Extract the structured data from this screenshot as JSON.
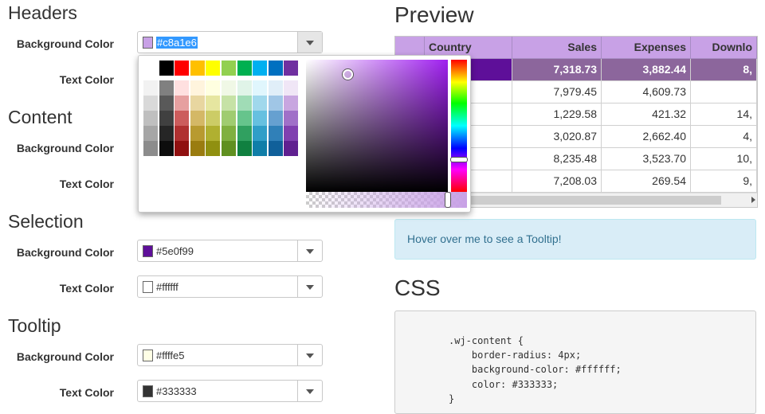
{
  "sections": {
    "headers": {
      "title": "Headers",
      "bg_label": "Background Color",
      "bg_value": "#c8a1e6",
      "bg_color": "#c8a1e6",
      "text_label": "Text Color"
    },
    "content": {
      "title": "Content",
      "bg_label": "Background Color",
      "text_label": "Text Color"
    },
    "selection": {
      "title": "Selection",
      "bg_label": "Background Color",
      "bg_value": "#5e0f99",
      "bg_color": "#5e0f99",
      "text_label": "Text Color",
      "text_value": "#ffffff",
      "text_color": "#ffffff"
    },
    "tooltip": {
      "title": "Tooltip",
      "bg_label": "Background Color",
      "bg_value": "#ffffe5",
      "bg_color": "#ffffe5",
      "text_label": "Text Color",
      "text_value": "#333333",
      "text_color": "#333333"
    }
  },
  "picker": {
    "palette_top": [
      "#ffffff",
      "#000000",
      "#ff0000",
      "#ffc000",
      "#ffff00",
      "#92d050",
      "#00b050",
      "#00b0f0",
      "#0070c0",
      "#7030a0"
    ],
    "palette_shades": [
      [
        "#f2f2f2",
        "#808080",
        "#ffe0e0",
        "#fff4dd",
        "#ffffe0",
        "#f0f8e6",
        "#e0f4e8",
        "#e0f6fd",
        "#e0eef8",
        "#f0e6f6"
      ],
      [
        "#d9d9d9",
        "#595959",
        "#e6a0a0",
        "#e8d6a0",
        "#e6e6a0",
        "#c6e2a6",
        "#a0dcb6",
        "#a0d8ec",
        "#a0c6e6",
        "#c8a6e0"
      ],
      [
        "#bfbfbf",
        "#404040",
        "#cc5c5c",
        "#d4b866",
        "#cccc66",
        "#a0cc70",
        "#66c48c",
        "#66c0e0",
        "#66a0d0",
        "#a070c8"
      ],
      [
        "#a6a6a6",
        "#262626",
        "#b03030",
        "#b89a30",
        "#b0b030",
        "#80b040",
        "#30a060",
        "#309ec8",
        "#3080b8",
        "#8040b0"
      ],
      [
        "#8c8c8c",
        "#0d0d0d",
        "#901010",
        "#9a7c10",
        "#909010",
        "#609020",
        "#108040",
        "#107ea8",
        "#10609a",
        "#602090"
      ]
    ]
  },
  "preview": {
    "title": "Preview",
    "grid": {
      "columns": [
        "",
        "Country",
        "Sales",
        "Expenses",
        "Downlo"
      ],
      "rows": [
        [
          "",
          "",
          "7,318.73",
          "3,882.44",
          "8,"
        ],
        [
          "",
          "",
          "7,979.45",
          "4,609.73",
          ""
        ],
        [
          "",
          "",
          "1,229.58",
          "421.32",
          "14,"
        ],
        [
          "",
          "",
          "3,020.87",
          "2,662.40",
          "4,"
        ],
        [
          "",
          "",
          "8,235.48",
          "3,523.70",
          "10,"
        ],
        [
          "",
          "",
          "7,208.03",
          "269.54",
          "9,"
        ]
      ]
    },
    "tooltip_text": "Hover over me to see a Tooltip!"
  },
  "css": {
    "title": "CSS",
    "code": ".wj-content {\n    border-radius: 4px;\n    background-color: #ffffff;\n    color: #333333;\n}"
  }
}
